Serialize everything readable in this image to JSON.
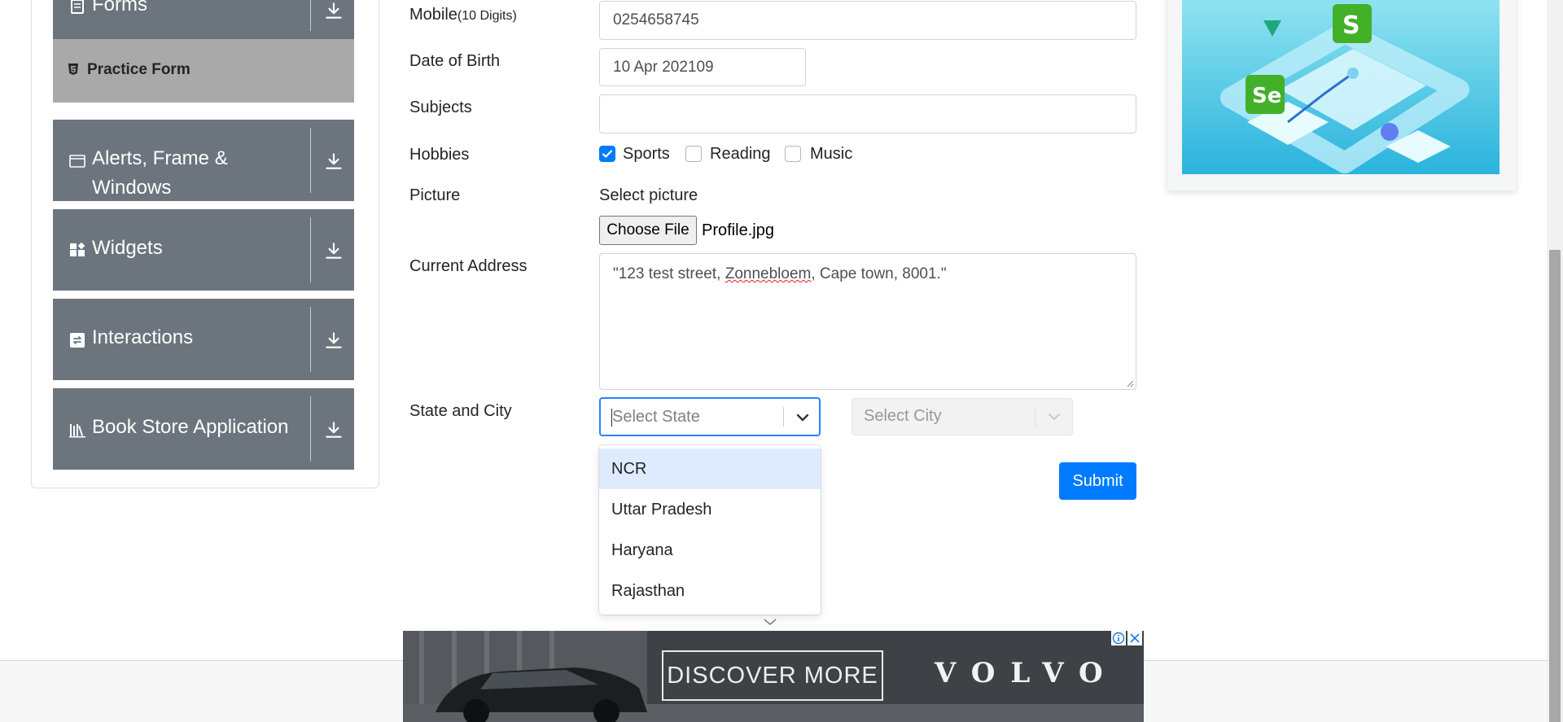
{
  "sidebar": {
    "forms_label": "Forms",
    "practice_form_label": "Practice Form",
    "groups": [
      {
        "label": "Alerts, Frame & Windows",
        "icon": "window-icon"
      },
      {
        "label": "Widgets",
        "icon": "widgets-icon"
      },
      {
        "label": "Interactions",
        "icon": "interactions-icon"
      },
      {
        "label": "Book Store Application",
        "icon": "book-icon"
      }
    ],
    "expand_icon": "download-arrow-icon"
  },
  "form": {
    "mobile_label": "Mobile",
    "mobile_hint": "(10 Digits)",
    "mobile_value": "0254658745",
    "dob_label": "Date of Birth",
    "dob_value": "10 Apr 202109",
    "subjects_label": "Subjects",
    "subjects_value": "",
    "hobbies_label": "Hobbies",
    "hobbies": [
      {
        "label": "Sports",
        "checked": true
      },
      {
        "label": "Reading",
        "checked": false
      },
      {
        "label": "Music",
        "checked": false
      }
    ],
    "picture_label": "Picture",
    "select_picture_label": "Select picture",
    "choose_file_label": "Choose File",
    "file_name": "Profile.jpg",
    "address_label": "Current Address",
    "address_part1": "\"123 test street, ",
    "address_misspelled": "Zonnebloem",
    "address_part2": ", Cape town, 8001.\"",
    "state_city_label": "State and City",
    "state_placeholder": "Select State",
    "city_placeholder": "Select City",
    "state_options": [
      "NCR",
      "Uttar Pradesh",
      "Haryana",
      "Rajasthan"
    ],
    "highlighted_option": "NCR",
    "submit_label": "Submit"
  },
  "ad": {
    "cta": "DISCOVER MORE",
    "brand": "VOLVO"
  },
  "colors": {
    "sidebar_group": "#6c757d",
    "practice_active": "#a9a9a9",
    "primary": "#007bff",
    "focus_border": "#2684ff",
    "option_highlight": "#deebff"
  }
}
